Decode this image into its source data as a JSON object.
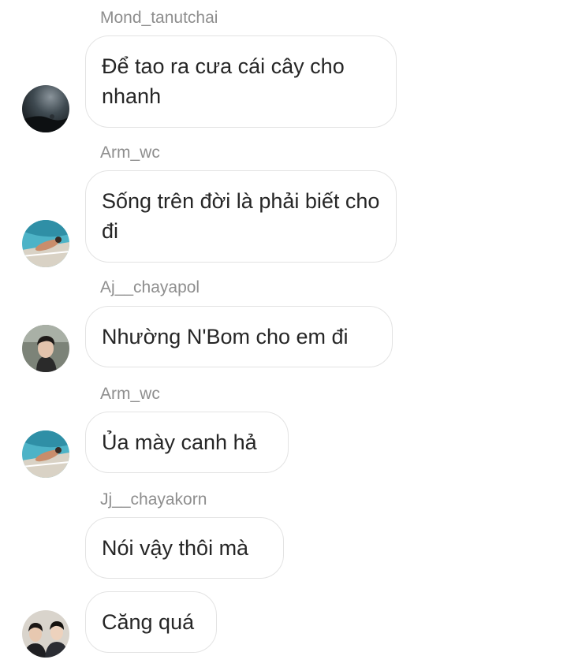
{
  "messages": [
    {
      "username": "Mond_tanutchai",
      "text": "Để tao ra cưa cái cây cho nhanh",
      "avatar_icon": "dark-sky-avatar"
    },
    {
      "username": "Arm_wc",
      "text": "Sống trên đời là phải biết cho đi",
      "avatar_icon": "pool-photo-avatar"
    },
    {
      "username": "Aj__chayapol",
      "text": "Nhường N'Bom cho em đi",
      "avatar_icon": "man-portrait-avatar"
    },
    {
      "username": "Arm_wc",
      "text": "Ủa mày canh hả",
      "avatar_icon": "pool-photo-avatar"
    },
    {
      "username": "Jj__chayakorn",
      "text": "Nói vậy thôi mà",
      "avatar_icon": "none"
    },
    {
      "username": "",
      "text": "Căng quá",
      "avatar_icon": "two-men-avatar"
    }
  ],
  "colors": {
    "username_text": "#8e8e8e",
    "message_text": "#262626",
    "bubble_border": "#e3e3e3",
    "background": "#ffffff"
  }
}
